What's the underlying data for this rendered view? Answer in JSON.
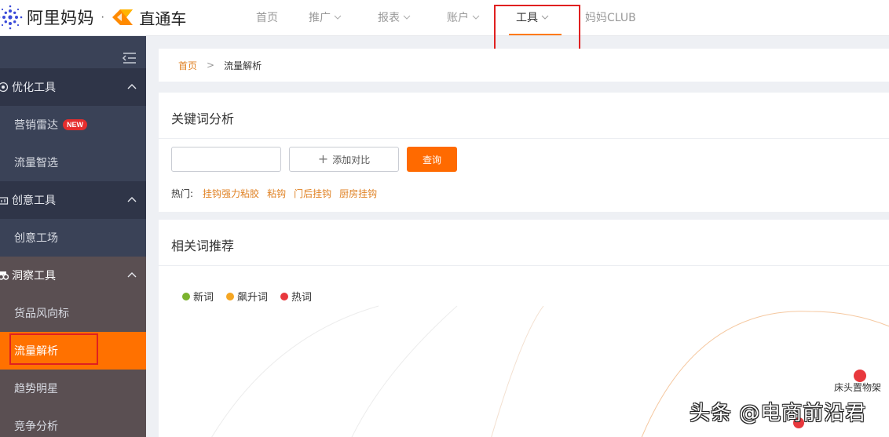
{
  "header": {
    "brand_name": "阿里妈妈",
    "brand_separator": "·",
    "product_name": "直通车",
    "nav": [
      {
        "label": "首页",
        "has_dropdown": false
      },
      {
        "label": "推广",
        "has_dropdown": true
      },
      {
        "label": "报表",
        "has_dropdown": true
      },
      {
        "label": "账户",
        "has_dropdown": true
      },
      {
        "label": "工具",
        "has_dropdown": true,
        "active": true
      },
      {
        "label": "妈妈CLUB",
        "has_dropdown": false
      }
    ],
    "accent_color": "#ff7a12"
  },
  "sidebar": {
    "groups": [
      {
        "label": "优化工具",
        "icon": "optimize-icon",
        "items": [
          {
            "label": "营销雷达",
            "badge": "NEW"
          },
          {
            "label": "流量智选"
          }
        ]
      },
      {
        "label": "创意工具",
        "icon": "creative-icon",
        "items": [
          {
            "label": "创意工场"
          }
        ]
      },
      {
        "label": "洞察工具",
        "icon": "insight-icon",
        "items": [
          {
            "label": "货品风向标"
          },
          {
            "label": "流量解析",
            "active": true
          },
          {
            "label": "趋势明星"
          },
          {
            "label": "竞争分析"
          }
        ]
      }
    ],
    "active_color": "#ff7100"
  },
  "breadcrumb": {
    "home": "首页",
    "separator": ">",
    "current": "流量解析"
  },
  "keyword_analysis": {
    "title": "关键词分析",
    "input_value": "",
    "input_placeholder": "",
    "compare_button": "添加对比",
    "query_button": "查询",
    "hot_label": "热门:",
    "hot_words": [
      "挂钩强力粘胶",
      "粘钩",
      "门后挂钩",
      "厨房挂钩"
    ]
  },
  "related_words": {
    "title": "相关词推荐",
    "legend": [
      {
        "label": "新词",
        "color": "#7bb32e"
      },
      {
        "label": "飙升词",
        "color": "#f5a623"
      },
      {
        "label": "热词",
        "color": "#e8383d"
      }
    ],
    "bubbles": [
      {
        "label": "床头置物架",
        "type": "热词"
      }
    ]
  },
  "watermark": "头条 @电商前沿君"
}
